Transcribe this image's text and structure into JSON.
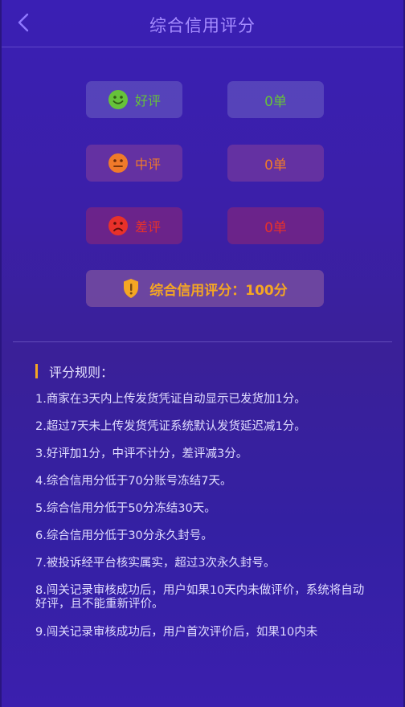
{
  "header": {
    "title": "综合信用评分",
    "back_icon": "chevron-left-icon"
  },
  "ratings": [
    {
      "label": "好评",
      "count": "0单",
      "icon": "smile-face-icon",
      "color": "#66c23a"
    },
    {
      "label": "中评",
      "count": "0单",
      "icon": "neutral-face-icon",
      "color": "#f07a2a"
    },
    {
      "label": "差评",
      "count": "0单",
      "icon": "sad-face-icon",
      "color": "#e8312a"
    }
  ],
  "score": {
    "text": "综合信用评分：100分",
    "icon": "shield-icon",
    "color": "#f5a623"
  },
  "rules": {
    "heading": "评分规则：",
    "items": [
      "1.商家在3天内上传发货凭证自动显示已发货加1分。",
      "2.超过7天未上传发货凭证系统默认发货延迟减1分。",
      "3.好评加1分，中评不计分，差评减3分。",
      "4.综合信用分低于70分账号冻结7天。",
      "5.综合信用分低于50分冻结30天。",
      "6.综合信用分低于30分永久封号。",
      "7.被投诉经平台核实属实，超过3次永久封号。",
      "8.闯关记录审核成功后，用户如果10天内未做评价，系统将自动好评，且不能重新评价。",
      "9.闯关记录审核成功后，用户首次评价后，如果10内未"
    ]
  }
}
